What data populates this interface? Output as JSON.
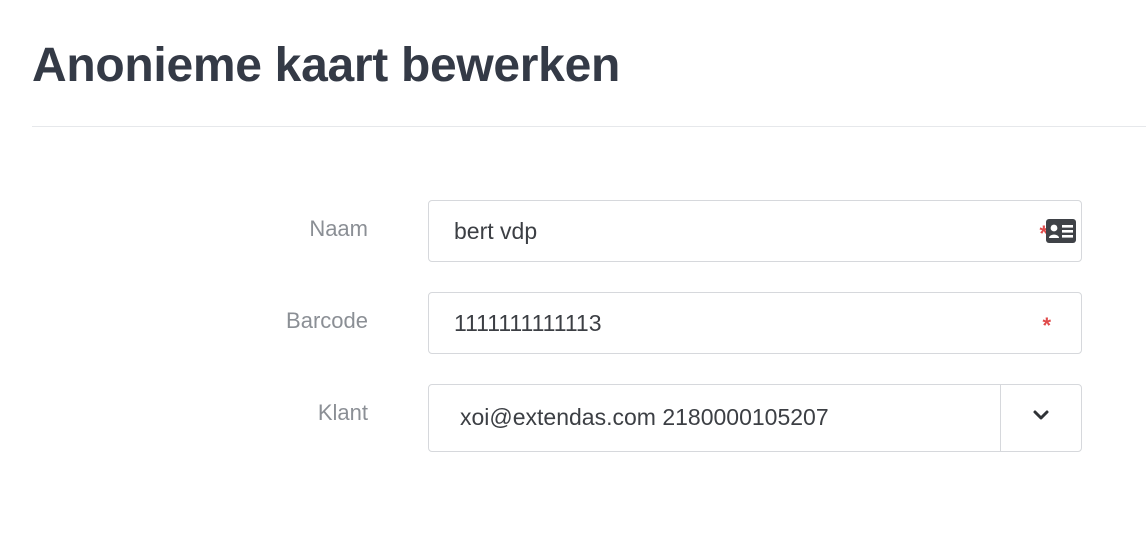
{
  "page": {
    "title": "Anonieme kaart bewerken"
  },
  "form": {
    "naam": {
      "label": "Naam",
      "value": "bert vdp",
      "required_mark": "*",
      "icon": "contact-card-icon"
    },
    "barcode": {
      "label": "Barcode",
      "value": "1111111111113",
      "required_mark": "*"
    },
    "klant": {
      "label": "Klant",
      "selected": "xoi@extendas.com 2180000105207",
      "icon": "chevron-down-icon"
    }
  },
  "colors": {
    "title": "#343a46",
    "label": "#8b8f95",
    "required": "#e04b4b",
    "border": "#d6d8dc"
  }
}
